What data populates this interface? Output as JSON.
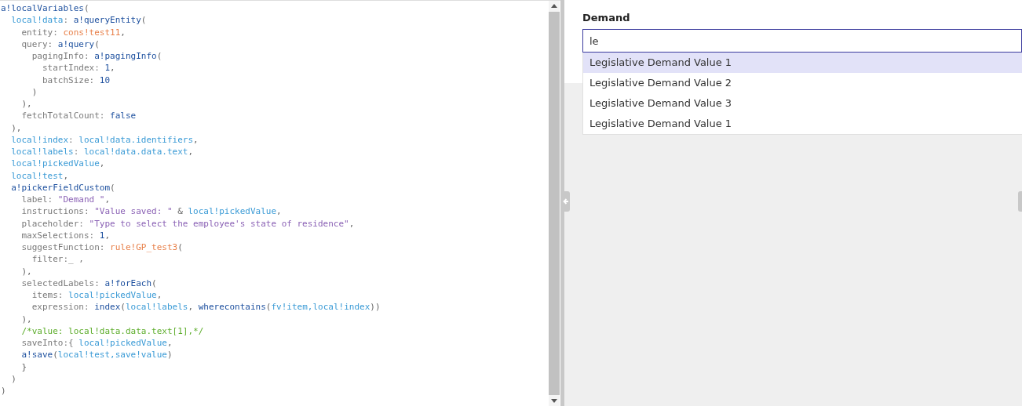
{
  "editor": {
    "lines": [
      [
        {
          "kind": "fn",
          "text": "a!localVariables"
        },
        {
          "kind": "punct",
          "text": "("
        }
      ],
      [
        {
          "kind": "var",
          "text": "  local!data"
        },
        {
          "kind": "key",
          "text": ": "
        },
        {
          "kind": "fn",
          "text": "a!queryEntity"
        },
        {
          "kind": "punct",
          "text": "("
        }
      ],
      [
        {
          "kind": "key",
          "text": "    entity: "
        },
        {
          "kind": "ref",
          "text": "cons!test11"
        },
        {
          "kind": "punct",
          "text": ","
        }
      ],
      [
        {
          "kind": "key",
          "text": "    query: "
        },
        {
          "kind": "fn",
          "text": "a!query"
        },
        {
          "kind": "punct",
          "text": "("
        }
      ],
      [
        {
          "kind": "key",
          "text": "      pagingInfo: "
        },
        {
          "kind": "fn",
          "text": "a!pagingInfo"
        },
        {
          "kind": "punct",
          "text": "("
        }
      ],
      [
        {
          "kind": "key",
          "text": "        startIndex: "
        },
        {
          "kind": "lit",
          "text": "1"
        },
        {
          "kind": "punct",
          "text": ","
        }
      ],
      [
        {
          "kind": "key",
          "text": "        batchSize: "
        },
        {
          "kind": "lit",
          "text": "10"
        }
      ],
      [
        {
          "kind": "punct",
          "text": "      )"
        }
      ],
      [
        {
          "kind": "punct",
          "text": "    ),"
        }
      ],
      [
        {
          "kind": "key",
          "text": "    fetchTotalCount: "
        },
        {
          "kind": "lit",
          "text": "false"
        }
      ],
      [
        {
          "kind": "punct",
          "text": "  ),"
        }
      ],
      [
        {
          "kind": "var",
          "text": "  local!index"
        },
        {
          "kind": "key",
          "text": ": "
        },
        {
          "kind": "var",
          "text": "local!data.identifiers"
        },
        {
          "kind": "punct",
          "text": ","
        }
      ],
      [
        {
          "kind": "var",
          "text": "  local!labels"
        },
        {
          "kind": "key",
          "text": ": "
        },
        {
          "kind": "var",
          "text": "local!data.data.text"
        },
        {
          "kind": "punct",
          "text": ","
        }
      ],
      [
        {
          "kind": "var",
          "text": "  local!pickedValue"
        },
        {
          "kind": "punct",
          "text": ","
        }
      ],
      [
        {
          "kind": "var",
          "text": "  local!test"
        },
        {
          "kind": "punct",
          "text": ","
        }
      ],
      [
        {
          "kind": "fn",
          "text": "  a!pickerFieldCustom"
        },
        {
          "kind": "punct",
          "text": "("
        }
      ],
      [
        {
          "kind": "key",
          "text": "    label: "
        },
        {
          "kind": "str",
          "text": "\"Demand \""
        },
        {
          "kind": "punct",
          "text": ","
        }
      ],
      [
        {
          "kind": "key",
          "text": "    instructions: "
        },
        {
          "kind": "str",
          "text": "\"Value saved: \""
        },
        {
          "kind": "punct",
          "text": " & "
        },
        {
          "kind": "var",
          "text": "local!pickedValue"
        },
        {
          "kind": "punct",
          "text": ","
        }
      ],
      [
        {
          "kind": "key",
          "text": "    placeholder: "
        },
        {
          "kind": "str",
          "text": "\"Type to select the employee's state of residence\""
        },
        {
          "kind": "punct",
          "text": ","
        }
      ],
      [
        {
          "kind": "key",
          "text": "    maxSelections: "
        },
        {
          "kind": "lit",
          "text": "1"
        },
        {
          "kind": "punct",
          "text": ","
        }
      ],
      [
        {
          "kind": "key",
          "text": "    suggestFunction: "
        },
        {
          "kind": "ref",
          "text": "rule!GP_test3"
        },
        {
          "kind": "punct",
          "text": "("
        }
      ],
      [
        {
          "kind": "key",
          "text": "      filter:_ ,"
        }
      ],
      [
        {
          "kind": "punct",
          "text": "    ),"
        }
      ],
      [
        {
          "kind": "key",
          "text": "    selectedLabels: "
        },
        {
          "kind": "fn",
          "text": "a!forEach"
        },
        {
          "kind": "punct",
          "text": "("
        }
      ],
      [
        {
          "kind": "key",
          "text": "      items: "
        },
        {
          "kind": "var",
          "text": "local!pickedValue"
        },
        {
          "kind": "punct",
          "text": ","
        }
      ],
      [
        {
          "kind": "key",
          "text": "      expression: "
        },
        {
          "kind": "fn",
          "text": "index"
        },
        {
          "kind": "punct",
          "text": "("
        },
        {
          "kind": "var",
          "text": "local!labels"
        },
        {
          "kind": "punct",
          "text": ", "
        },
        {
          "kind": "fn",
          "text": "wherecontains"
        },
        {
          "kind": "punct",
          "text": "("
        },
        {
          "kind": "var",
          "text": "fv!item,local!index"
        },
        {
          "kind": "punct",
          "text": "))"
        }
      ],
      [
        {
          "kind": "punct",
          "text": "    ),"
        }
      ],
      [
        {
          "kind": "cmt",
          "text": "    /*value: local!data.data.text[1],*/"
        }
      ],
      [
        {
          "kind": "key",
          "text": "    saveInto:{ "
        },
        {
          "kind": "var",
          "text": "local!pickedValue"
        },
        {
          "kind": "punct",
          "text": ","
        }
      ],
      [
        {
          "kind": "fn",
          "text": "    a!save"
        },
        {
          "kind": "punct",
          "text": "("
        },
        {
          "kind": "var",
          "text": "local!test,save!value"
        },
        {
          "kind": "punct",
          "text": ")"
        }
      ],
      [
        {
          "kind": "punct",
          "text": "    }"
        }
      ],
      [
        {
          "kind": "punct",
          "text": "  )"
        }
      ],
      [
        {
          "kind": "punct",
          "text": ")"
        }
      ]
    ]
  },
  "form": {
    "label": "Demand",
    "value": "le",
    "suggestions": [
      {
        "text": "Legislative Demand Value 1",
        "selected": true
      },
      {
        "text": "Legislative Demand Value 2",
        "selected": false
      },
      {
        "text": "Legislative Demand Value 3",
        "selected": false
      },
      {
        "text": "Legislative Demand Value 1",
        "selected": false
      }
    ]
  }
}
